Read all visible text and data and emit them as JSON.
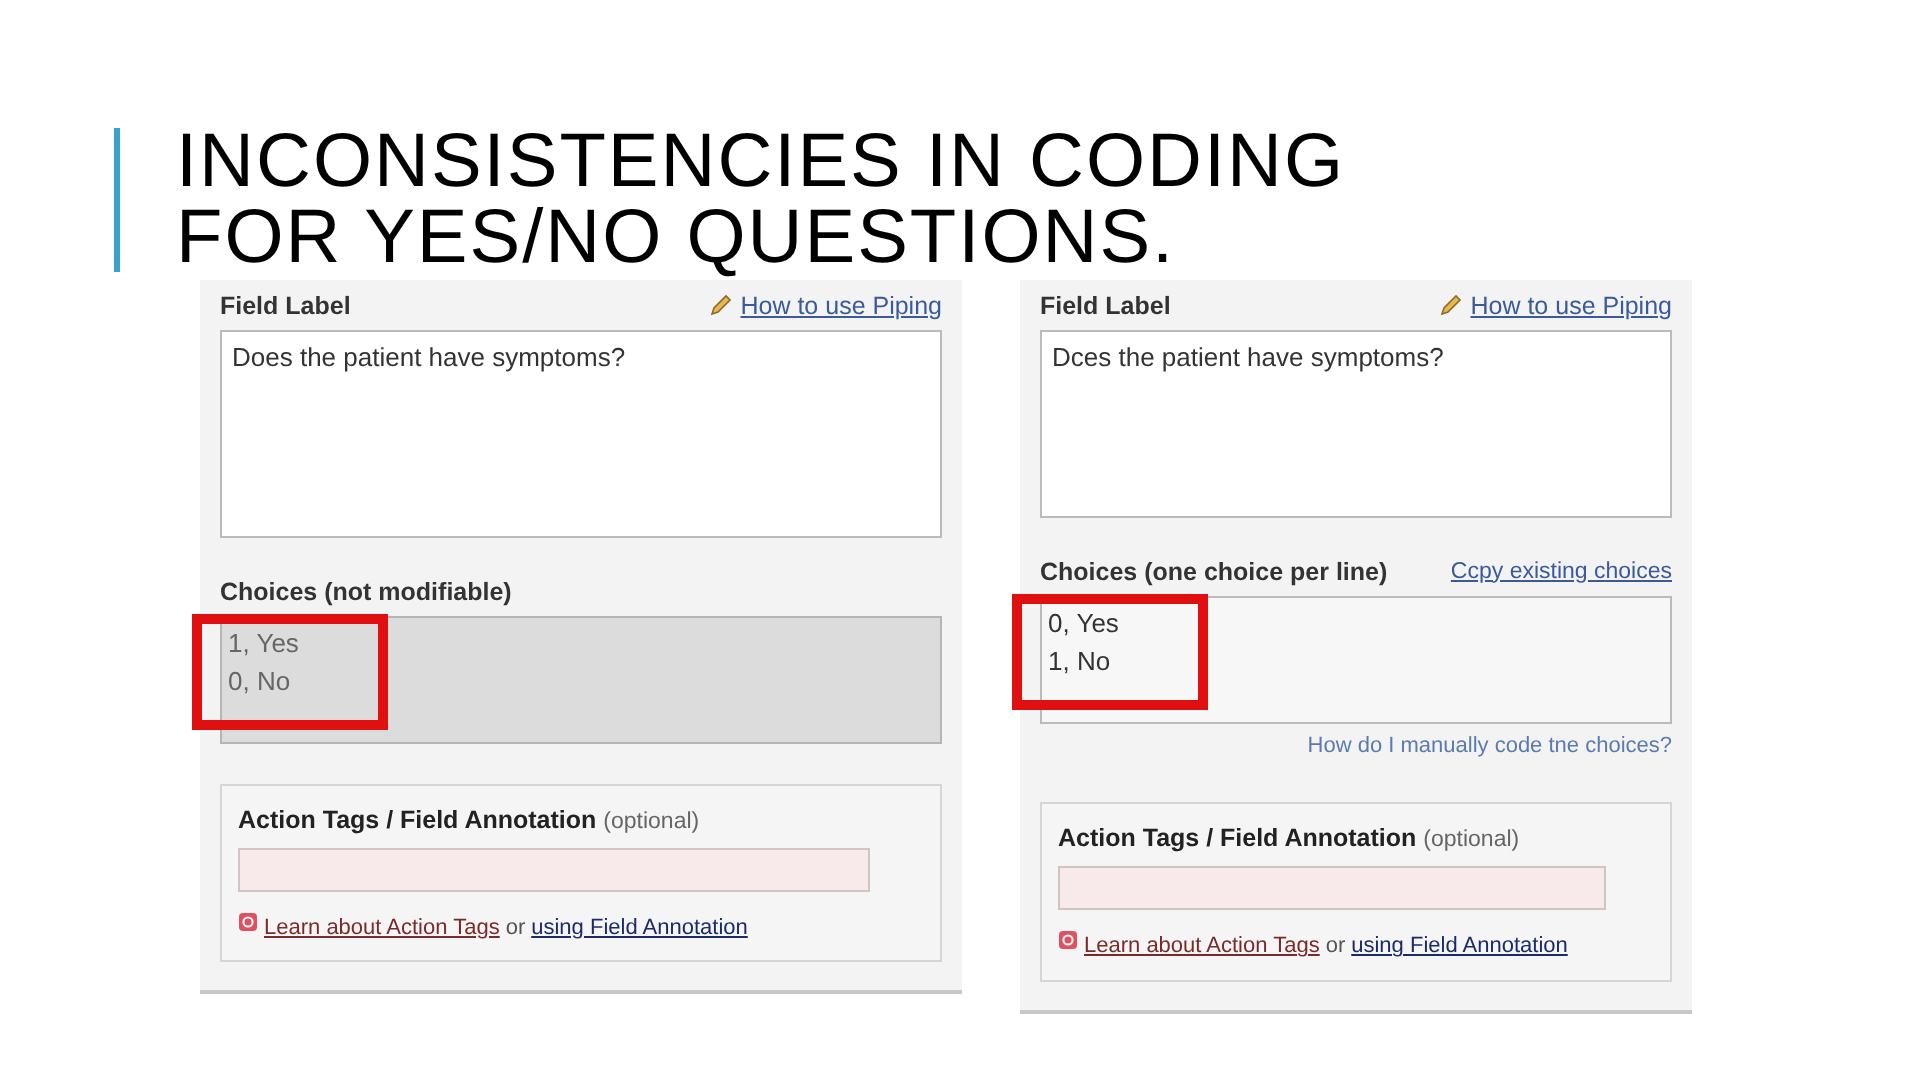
{
  "slide_title": "INCONSISTENCIES IN CODING FOR YES/NO QUESTIONS.",
  "panels": [
    {
      "field_label": {
        "label": "Field Label",
        "link": "How to use Piping",
        "value": "Does the patient have symptoms?"
      },
      "choices": {
        "label": "Choices (not modifiable)",
        "disabled": true,
        "highlighted": true,
        "lines": [
          "1, Yes",
          "0, No"
        ]
      },
      "action_tags": {
        "label": "Action Tags / Field Annotation",
        "optional": "(optional)",
        "link_1": "Learn about Action Tags",
        "connector": "or",
        "link_2": "using Field Annotation"
      }
    },
    {
      "field_label": {
        "label": "Field Label",
        "link": "How to use Piping",
        "value": "Dces the patient have symptoms?"
      },
      "choices": {
        "label": "Choices (one choice per line)",
        "link": "Ccpy existing choices",
        "disabled": false,
        "highlighted": true,
        "lines": [
          "0, Yes",
          "1, No"
        ],
        "help_link": "How do I manually code tne choices?"
      },
      "action_tags": {
        "label": "Action Tags / Field Annotation",
        "optional": "(optional)",
        "link_1": "Learn about Action Tags",
        "connector": "or",
        "link_2": "using Field Annotation"
      }
    }
  ]
}
